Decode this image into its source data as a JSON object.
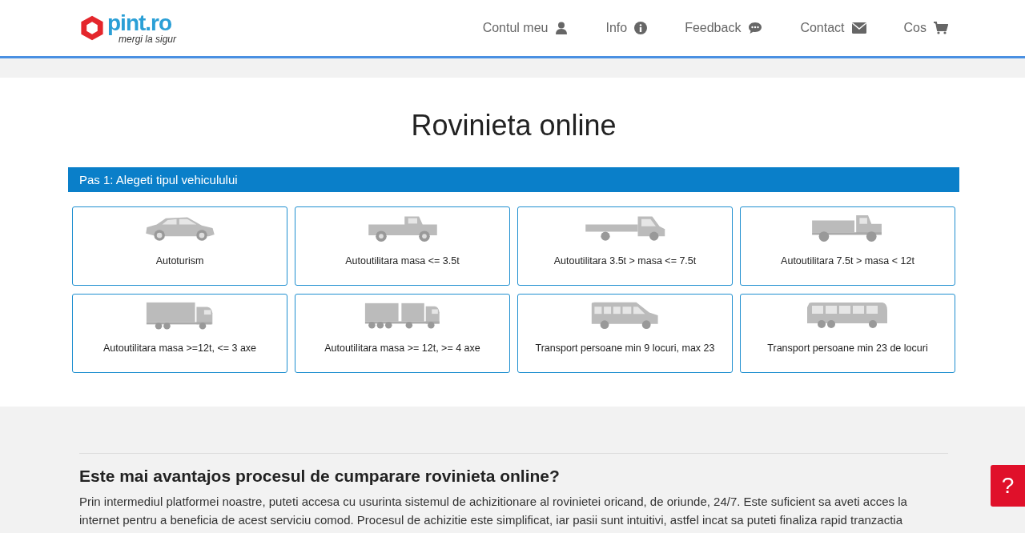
{
  "logo": {
    "name": "pint.ro",
    "tagline": "mergi la sigur"
  },
  "nav": [
    {
      "label": "Contul meu",
      "kind": "user"
    },
    {
      "label": "Info",
      "kind": "info"
    },
    {
      "label": "Feedback",
      "kind": "comment"
    },
    {
      "label": "Contact",
      "kind": "envelope"
    },
    {
      "label": "Cos",
      "kind": "cart"
    }
  ],
  "title": "Rovinieta online",
  "step": "Pas 1: Alegeti tipul vehiculului",
  "vehicles": [
    {
      "kind": "car",
      "label": "Autoturism"
    },
    {
      "kind": "pickup",
      "label": "Autoutilitara masa <= 3.5t"
    },
    {
      "kind": "flatbed",
      "label": "Autoutilitara 3.5t > masa <= 7.5t"
    },
    {
      "kind": "dump",
      "label": "Autoutilitara 7.5t > masa < 12t"
    },
    {
      "kind": "truck",
      "label": "Autoutilitara masa >=12t, <= 3 axe"
    },
    {
      "kind": "roadtrain",
      "label": "Autoutilitara masa >= 12t, >= 4 axe"
    },
    {
      "kind": "van",
      "label": "Transport persoane min 9 locuri, max 23"
    },
    {
      "kind": "bus",
      "label": "Transport persoane min 23 de locuri"
    }
  ],
  "article": {
    "heading": "Este mai avantajos procesul de cumparare rovinieta online?",
    "lines": [
      "Prin intermediul platformei noastre, puteti accesa cu usurinta sistemul de achizitionare al rovinietei oricand, de oriunde, 24/7. Este suficient sa aveti acces la",
      "internet pentru a beneficia de acest serviciu comod. Procesul de achizitie este simplificat, iar pasii sunt intuitivi, astfel incat sa puteti finaliza rapid tranzactia"
    ]
  },
  "help": "?"
}
